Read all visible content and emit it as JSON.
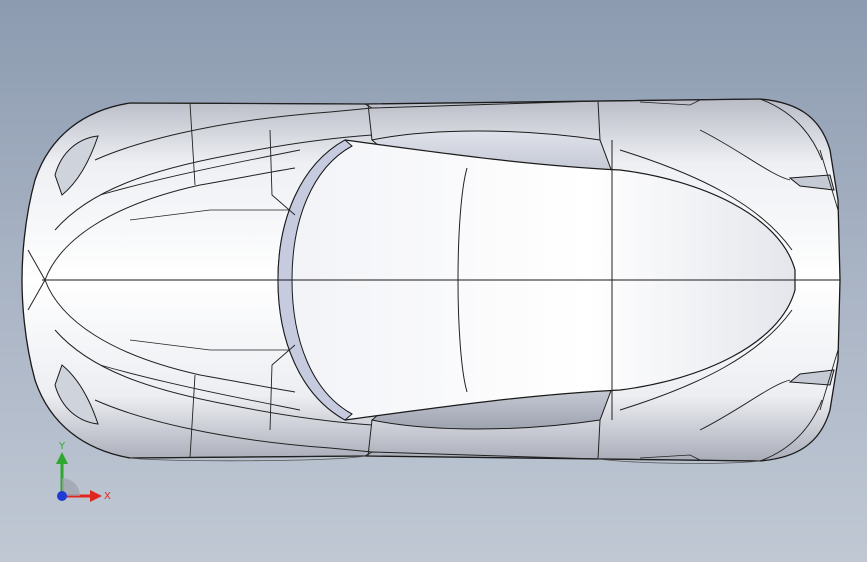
{
  "triad": {
    "x_label": "X",
    "y_label": "Y",
    "x_color": "#e0261e",
    "y_color": "#2ea82e",
    "z_color": "#1f3bd6"
  },
  "scene": {
    "background_top": "#8c9bb0",
    "background_bottom": "#c0c8d4",
    "model_fill": "#f4f5f8",
    "edge_color": "#1a1a1a"
  }
}
